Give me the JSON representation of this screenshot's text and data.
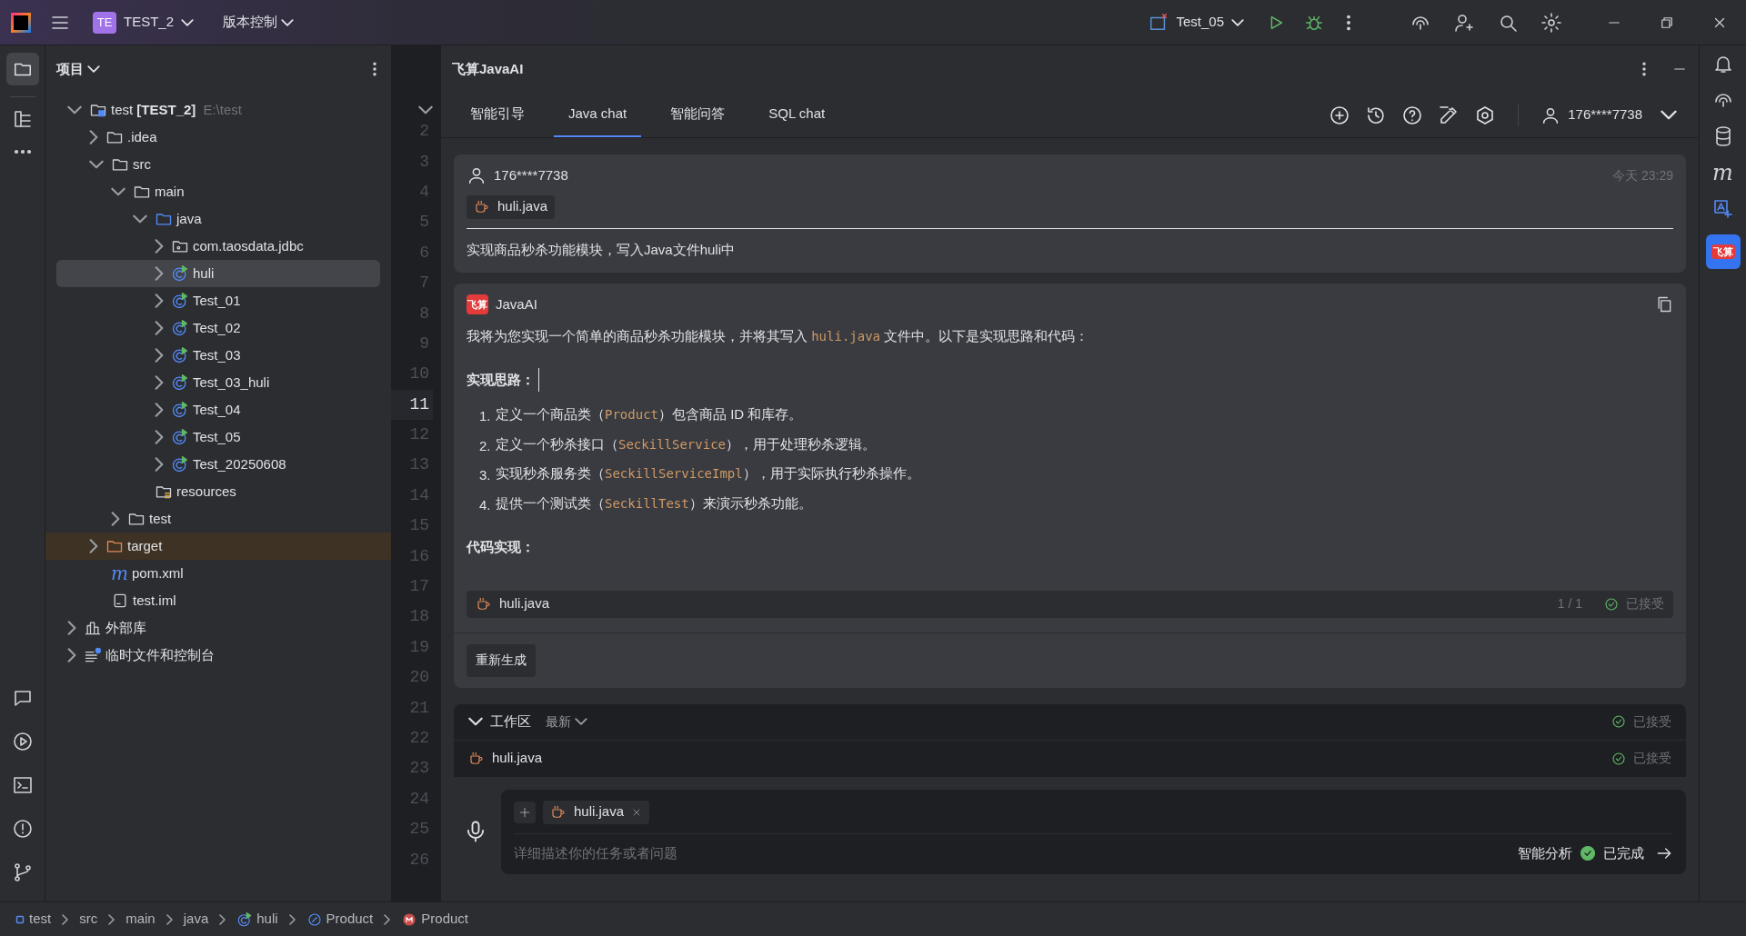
{
  "title_bar": {
    "project_badge": "TE",
    "project": "TEST_2",
    "vcs": "版本控制",
    "run_config": "Test_05"
  },
  "project_panel": {
    "title": "项目",
    "tree": [
      {
        "label": "test **[TEST_2]**",
        "hint": "E:\\test",
        "kind": "module",
        "expanded": true,
        "selected": false,
        "children": [
          {
            "label": ".idea",
            "kind": "folder",
            "expanded": false,
            "selected": false
          },
          {
            "label": "src",
            "kind": "folder",
            "expanded": true,
            "selected": false,
            "children": [
              {
                "label": "main",
                "kind": "folder",
                "expanded": true,
                "selected": false,
                "children": [
                  {
                    "label": "java",
                    "kind": "source",
                    "expanded": true,
                    "selected": false,
                    "children": [
                      {
                        "label": "com.taosdata.jdbc",
                        "kind": "package",
                        "expanded": false,
                        "selected": false
                      },
                      {
                        "label": "huli",
                        "kind": "class",
                        "expanded": false,
                        "selected": true
                      },
                      {
                        "label": "Test_01",
                        "kind": "class",
                        "expanded": false,
                        "selected": false
                      },
                      {
                        "label": "Test_02",
                        "kind": "class",
                        "expanded": false,
                        "selected": false
                      },
                      {
                        "label": "Test_03",
                        "kind": "class",
                        "expanded": false,
                        "selected": false
                      },
                      {
                        "label": "Test_03_huli",
                        "kind": "class",
                        "expanded": false,
                        "selected": false
                      },
                      {
                        "label": "Test_04",
                        "kind": "class",
                        "expanded": false,
                        "selected": false
                      },
                      {
                        "label": "Test_05",
                        "kind": "class",
                        "expanded": false,
                        "selected": false
                      },
                      {
                        "label": "Test_20250608",
                        "kind": "class",
                        "expanded": false,
                        "selected": false
                      }
                    ]
                  },
                  {
                    "label": "resources",
                    "kind": "resources",
                    "selected": false
                  }
                ]
              },
              {
                "label": "test",
                "kind": "folder",
                "expanded": false,
                "selected": false
              }
            ]
          },
          {
            "label": "target",
            "kind": "excluded",
            "expanded": false,
            "selected": false
          },
          {
            "label": "pom.xml",
            "kind": "maven",
            "glyph": "m",
            "selected": false
          },
          {
            "label": "test.iml",
            "kind": "file",
            "selected": false
          }
        ]
      },
      {
        "label": "外部库",
        "kind": "library",
        "expanded": false,
        "selected": false
      },
      {
        "label": "临时文件和控制台",
        "kind": "scratches",
        "expanded": false,
        "selected": false
      }
    ]
  },
  "gutter": [
    {
      "number": "2",
      "current": false
    },
    {
      "number": "3",
      "current": false
    },
    {
      "number": "4",
      "current": false
    },
    {
      "number": "5",
      "current": false
    },
    {
      "number": "6",
      "current": false
    },
    {
      "number": "7",
      "current": false
    },
    {
      "number": "8",
      "current": false
    },
    {
      "number": "9",
      "current": false
    },
    {
      "number": "10",
      "current": false
    },
    {
      "number": "11",
      "current": true
    },
    {
      "number": "12",
      "current": false
    },
    {
      "number": "13",
      "current": false
    },
    {
      "number": "14",
      "current": false
    },
    {
      "number": "15",
      "current": false
    },
    {
      "number": "16",
      "current": false
    },
    {
      "number": "17",
      "current": false
    },
    {
      "number": "18",
      "current": false
    },
    {
      "number": "19",
      "current": false
    },
    {
      "number": "20",
      "current": false
    },
    {
      "number": "21",
      "current": false
    },
    {
      "number": "22",
      "current": false
    },
    {
      "number": "23",
      "current": false
    },
    {
      "number": "24",
      "current": false
    },
    {
      "number": "25",
      "current": false
    },
    {
      "number": "26",
      "current": false
    }
  ],
  "chat": {
    "title": "飞算JavaAI",
    "tabs": [
      {
        "label": "智能引导",
        "selected": false
      },
      {
        "label": "Java chat",
        "selected": true
      },
      {
        "label": "智能问答",
        "selected": false
      },
      {
        "label": "SQL chat",
        "selected": false
      }
    ],
    "account": "176****7738",
    "user_message": {
      "author": "176****7738",
      "time": "今天 23:29",
      "attachment": "huli.java",
      "text": "实现商品秒杀功能模块，写入Java文件huli中"
    },
    "ai_message": {
      "logo": "飞算",
      "author": "JavaAI",
      "intro": [
        {
          "text": "我将为您实现一个简单的商品秒杀功能模块，并将其写入 ",
          "code": false
        },
        {
          "text": "huli.java",
          "code": true
        },
        {
          "text": " 文件中。以下是实现思路和代码：",
          "code": false
        }
      ],
      "heading_1": "实现思路：",
      "steps": [
        {
          "number": "1.",
          "parts": [
            {
              "text": "定义一个商品类（",
              "code": false
            },
            {
              "text": "Product",
              "code": true
            },
            {
              "text": "）包含商品 ID 和库存。",
              "code": false
            }
          ]
        },
        {
          "number": "2.",
          "parts": [
            {
              "text": "定义一个秒杀接口（",
              "code": false
            },
            {
              "text": "SeckillService",
              "code": true
            },
            {
              "text": "），用于处理秒杀逻辑。",
              "code": false
            }
          ]
        },
        {
          "number": "3.",
          "parts": [
            {
              "text": "实现秒杀服务类（",
              "code": false
            },
            {
              "text": "SeckillServiceImpl",
              "code": true
            },
            {
              "text": "），用于实际执行秒杀操作。",
              "code": false
            }
          ]
        },
        {
          "number": "4.",
          "parts": [
            {
              "text": "提供一个测试类（",
              "code": false
            },
            {
              "text": "SeckillTest",
              "code": true
            },
            {
              "text": "）来演示秒杀功能。",
              "code": false
            }
          ]
        }
      ],
      "heading_2": "代码实现：",
      "file": {
        "name": "huli.java",
        "count": "1 / 1",
        "status": "已接受"
      },
      "regenerate": "重新生成"
    },
    "workspace": {
      "title": "工作区",
      "filter": "最新",
      "status": "已接受",
      "files": [
        {
          "name": "huli.java",
          "status": "已接受"
        }
      ]
    },
    "input": {
      "attachment": "huli.java",
      "placeholder": "详细描述你的任务或者问题",
      "mode": "智能分析",
      "state": "已完成"
    }
  },
  "right_strip": {
    "maven_glyph": "m",
    "plugin_logo": "飞算"
  },
  "breadcrumbs": [
    {
      "label": "test",
      "kind": "module"
    },
    {
      "label": "src",
      "kind": "plain"
    },
    {
      "label": "main",
      "kind": "plain"
    },
    {
      "label": "java",
      "kind": "plain"
    },
    {
      "label": "huli",
      "kind": "class"
    },
    {
      "label": "Product",
      "kind": "field"
    },
    {
      "label": "Product",
      "kind": "method"
    }
  ]
}
